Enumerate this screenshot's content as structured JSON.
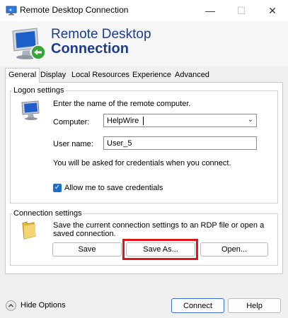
{
  "window": {
    "title": "Remote Desktop Connection",
    "controls": {
      "minimize": "—",
      "maximize": "☐",
      "close": "✕"
    }
  },
  "banner": {
    "line1": "Remote Desktop",
    "line2": "Connection"
  },
  "tabs": [
    {
      "label": "General"
    },
    {
      "label": "Display"
    },
    {
      "label": "Local Resources"
    },
    {
      "label": "Experience"
    },
    {
      "label": "Advanced"
    }
  ],
  "logon": {
    "group_label": "Logon settings",
    "instruction": "Enter the name of the remote computer.",
    "computer_label": "Computer:",
    "computer_value": "HelpWire",
    "username_label": "User name:",
    "username_value": "User_5",
    "credentials_note": "You will be asked for credentials when you connect.",
    "save_credentials_label": "Allow me to save credentials",
    "save_credentials_checked": true
  },
  "connection": {
    "group_label": "Connection settings",
    "description_line1": "Save the current connection settings to an RDP file or open a",
    "description_line2": "saved connection.",
    "save_label": "Save",
    "save_as_label": "Save As...",
    "open_label": "Open..."
  },
  "footer": {
    "hide_options_label": "Hide Options",
    "connect_label": "Connect",
    "help_label": "Help"
  },
  "colors": {
    "accent": "#1a6fc9",
    "highlight": "#e0151b",
    "banner_text": "#1d3d8f"
  },
  "icons": [
    "remote-desktop-icon",
    "monitor-icon",
    "folder-icon",
    "chevron-down-icon",
    "chevron-up-icon",
    "check-icon"
  ]
}
